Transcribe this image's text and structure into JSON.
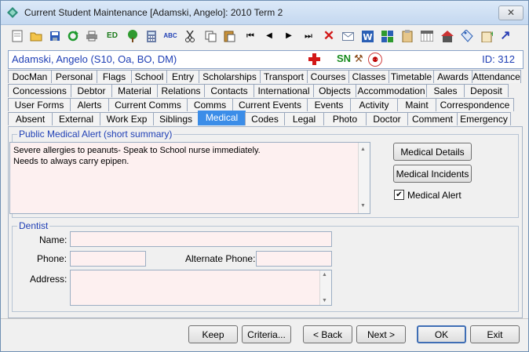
{
  "window": {
    "title": "Current Student Maintenance  [Adamski, Angelo]:  2010 Term 2",
    "close_label": "✕"
  },
  "toolbar": {
    "icons": [
      "new-document-icon",
      "open-folder-icon",
      "save-icon",
      "refresh-icon",
      "print-icon",
      "edit-icon",
      "tree-icon",
      "calculator-icon",
      "spellcheck-icon",
      "cut-icon",
      "copy-icon",
      "paste-icon",
      "first-record-icon",
      "previous-record-icon",
      "next-record-icon",
      "last-record-icon",
      "delete-icon",
      "email-icon",
      "word-icon",
      "grid-icon",
      "clipboard-icon",
      "calendar-icon",
      "house-icon",
      "tag-icon",
      "notes-icon",
      "arrow-icon"
    ]
  },
  "student_bar": {
    "name": "Adamski, Angelo (S10, Oa, BO, DM)",
    "sn_badge": "SN",
    "id_text": "ID: 312"
  },
  "tabs": {
    "row1": [
      "DocMan",
      "Personal",
      "Flags",
      "School",
      "Entry",
      "Scholarships",
      "Transport",
      "Courses",
      "Classes",
      "Timetable",
      "Awards",
      "Attendance"
    ],
    "row2": [
      "Concessions",
      "Debtor",
      "Material",
      "Relations",
      "Contacts",
      "International",
      "Objects",
      "Accommodation",
      "Sales",
      "Deposit"
    ],
    "row3": [
      "User Forms",
      "Alerts",
      "Current Comms",
      "Comms",
      "Current Events",
      "Events",
      "Activity",
      "Maint",
      "Correspondence"
    ],
    "row4": [
      "Absent",
      "External",
      "Work Exp",
      "Siblings",
      "Medical",
      "Codes",
      "Legal",
      "Photo",
      "Doctor",
      "Comment",
      "Emergency"
    ],
    "active": "Medical"
  },
  "medical": {
    "group_title": "Public Medical Alert (short summary)",
    "alert_text_line1": "Severe allergies to peanuts- Speak to School nurse immediately.",
    "alert_text_line2": "Needs to always carry epipen.",
    "details_button": "Medical Details",
    "incidents_button": "Medical Incidents",
    "alert_checkbox_label": "Medical Alert",
    "alert_checked": true
  },
  "dentist": {
    "group_title": "Dentist",
    "name_label": "Name:",
    "name_value": "",
    "phone_label": "Phone:",
    "phone_value": "",
    "alt_phone_label": "Alternate Phone:",
    "alt_phone_value": "",
    "address_label": "Address:",
    "address_value": ""
  },
  "buttons": {
    "keep": "Keep",
    "criteria": "Criteria...",
    "back": "< Back",
    "next": "Next >",
    "ok": "OK",
    "exit": "Exit"
  },
  "colors": {
    "accent": "#3b8de8",
    "text_blue": "#1f3fb5",
    "field_bg": "#fdf0f0"
  }
}
